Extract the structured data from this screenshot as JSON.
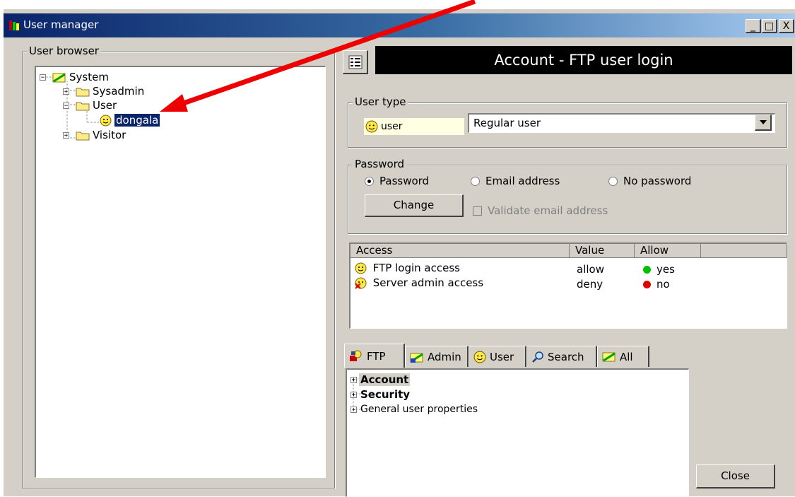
{
  "window": {
    "title": "User manager",
    "controls": {
      "minimize": "_",
      "maximize": "□",
      "close": "X"
    }
  },
  "browser": {
    "legend": "User browser",
    "tree": [
      {
        "label": "System",
        "icon": "system-icon",
        "expander": "−"
      },
      {
        "label": "Sysadmin",
        "icon": "folder-icon",
        "expander": "+"
      },
      {
        "label": "User",
        "icon": "folder-icon",
        "expander": "−"
      },
      {
        "label": "dongala",
        "icon": "smiley-icon",
        "selected": true
      },
      {
        "label": "Visitor",
        "icon": "folder-icon",
        "expander": "+"
      }
    ]
  },
  "header": {
    "title": "Account - FTP user login",
    "button_icon": "grid-icon"
  },
  "user_type": {
    "legend": "User type",
    "badge": "user",
    "select_value": "Regular user"
  },
  "password": {
    "legend": "Password",
    "options": [
      "Password",
      "Email address",
      "No password"
    ],
    "selected": "Password",
    "change_label": "Change",
    "validate_label": "Validate email address"
  },
  "access_table": {
    "columns": [
      "Access",
      "Value",
      "Allow"
    ],
    "rows": [
      {
        "access": "FTP login access",
        "value": "allow",
        "allow": "yes",
        "color": "#00c000"
      },
      {
        "access": "Server admin access",
        "value": "deny",
        "allow": "no",
        "color": "#e00000"
      }
    ]
  },
  "tabs": [
    {
      "label": "FTP",
      "icon": "ftp-icon",
      "active": true
    },
    {
      "label": "Admin",
      "icon": "admin-icon"
    },
    {
      "label": "User",
      "icon": "smiley-icon"
    },
    {
      "label": "Search",
      "icon": "search-icon"
    },
    {
      "label": "All",
      "icon": "all-icon"
    }
  ],
  "properties": [
    {
      "label": "Account",
      "bold": true
    },
    {
      "label": "Security",
      "bold": true
    },
    {
      "label": "General user properties",
      "bold": false
    }
  ],
  "close_label": "Close",
  "colors": {
    "titlebar": "#0a246a",
    "selection": "#0a246a",
    "header_bg": "#000000",
    "annotation_arrow": "#ee0000"
  }
}
